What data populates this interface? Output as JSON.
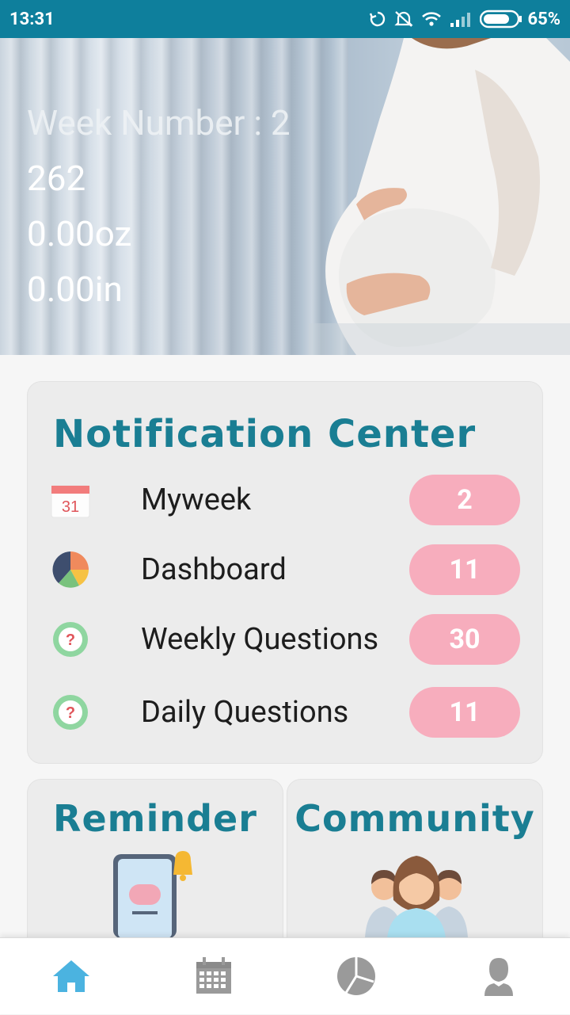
{
  "status_bar": {
    "time": "13:31",
    "battery": "65%"
  },
  "hero": {
    "week_label": "Week Number : 2",
    "days": "262",
    "weight": "0.00oz",
    "length": "0.00in"
  },
  "notification_center": {
    "title": "Notification Center",
    "items": [
      {
        "label": "Myweek",
        "count": "2",
        "icon": "calendar-icon",
        "calendar_day": "31"
      },
      {
        "label": "Dashboard",
        "count": "11",
        "icon": "pie-chart-icon"
      },
      {
        "label": "Weekly Questions",
        "count": "30",
        "icon": "question-bubble-icon"
      },
      {
        "label": "Daily Questions",
        "count": "11",
        "icon": "question-bubble-icon"
      }
    ]
  },
  "reminder": {
    "title": "Reminder",
    "icon": "phone-bell-icon"
  },
  "community": {
    "title": "Community",
    "icon": "people-group-icon"
  },
  "bottom_nav": {
    "items": [
      {
        "name": "home",
        "icon": "home-icon",
        "active": true
      },
      {
        "name": "calendar",
        "icon": "calendar-icon",
        "active": false
      },
      {
        "name": "dashboard",
        "icon": "pie-chart-icon",
        "active": false
      },
      {
        "name": "profile",
        "icon": "user-icon",
        "active": false
      }
    ]
  },
  "colors": {
    "status_bar": "#0e7f9c",
    "title_teal": "#1a7e93",
    "badge_pink": "#f7adbd",
    "nav_active": "#4bb3e0",
    "nav_inactive": "#9a9a9a"
  }
}
